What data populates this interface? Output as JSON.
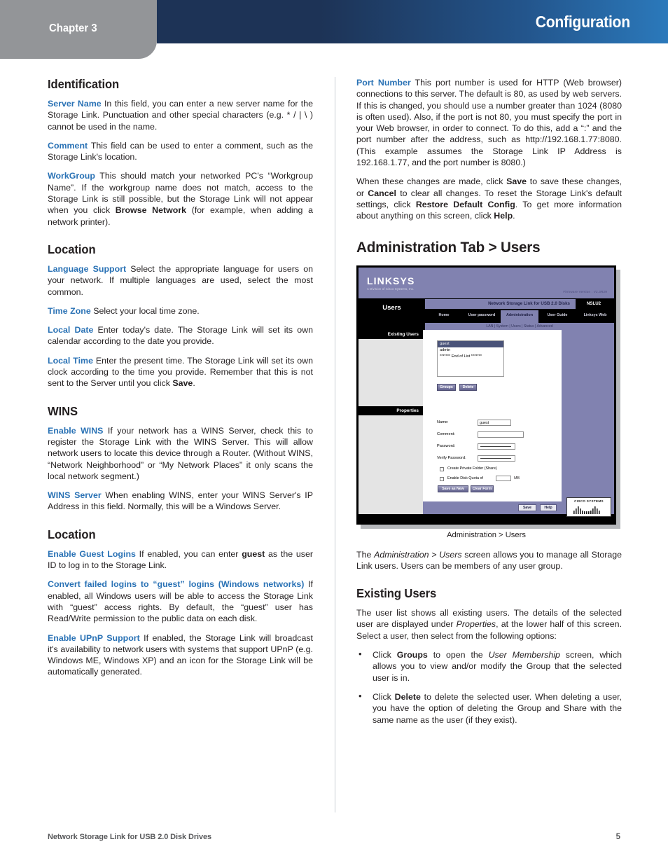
{
  "header": {
    "chapter": "Chapter 3",
    "title": "Configuration"
  },
  "left_column": {
    "identification": {
      "heading": "Identification",
      "server_name": {
        "lead": "Server Name",
        "text": " In this field, you can enter a new server name for the Storage Link. Punctuation and other special characters (e.g. * / | \\ ) cannot be used in the name."
      },
      "comment": {
        "lead": "Comment",
        "text": "  This field can be used to enter a comment, such as the Storage Link's location."
      },
      "workgroup": {
        "lead": "WorkGroup",
        "text_1": " This should match your networked PC's “Workgroup Name”. If the workgroup name does not match, access to the Storage Link is still possible, but the Storage Link will not appear when you click ",
        "bold_1": "Browse Network",
        "text_2": " (for example, when adding a network printer)."
      }
    },
    "location_1": {
      "heading": "Location",
      "language_support": {
        "lead": "Language Support",
        "text": "  Select the appropriate language for users on your network. If multiple languages are used, select the most common."
      },
      "time_zone": {
        "lead": "Time Zone",
        "text": "  Select your local time zone."
      },
      "local_date": {
        "lead": "Local Date",
        "text": "  Enter today's date. The Storage Link will set its own calendar according to the date you provide."
      },
      "local_time": {
        "lead": "Local Time",
        "text_1": " Enter the present time. The Storage Link will set its own clock according to the time you provide. Remember that this is not sent to the Server until you click ",
        "bold_1": "Save",
        "text_2": "."
      }
    },
    "wins": {
      "heading": "WINS",
      "enable_wins": {
        "lead": "Enable WINS",
        "text": "  If your network has a WINS Server, check this to register the Storage Link with the WINS Server. This will allow network users to locate this device through a Router. (Without WINS, “Network Neighborhood” or “My Network Places” it only scans the local network segment.)"
      },
      "wins_server": {
        "lead": "WINS Server",
        "text": " When enabling WINS, enter your WINS Server's IP Address in this field. Normally, this will be a Windows Server."
      }
    },
    "location_2": {
      "heading": "Location",
      "enable_guest_logins": {
        "lead": "Enable Guest Logins",
        "text_1": "  If enabled, you can enter ",
        "bold_1": "guest",
        "text_2": " as the user ID to log in to the Storage Link."
      },
      "convert_failed_logins": {
        "lead": "Convert failed logins to “guest” logins (Windows networks)",
        "text": " If enabled, all Windows users will be able to access the Storage Link with “guest” access rights. By default, the “guest” user has Read/Write permission to the public data on each disk."
      },
      "enable_upnp": {
        "lead": "Enable UPnP Support",
        "text": "  If enabled, the Storage Link will broadcast it's availability to network users with systems that support UPnP (e.g. Windows ME, Windows XP) and an icon for the Storage Link will be automatically generated."
      }
    }
  },
  "right_column": {
    "port_number": {
      "lead": "Port Number",
      "text": "  This port number is used for HTTP (Web browser) connections to this server. The default is 80, as used by web servers. If this is changed, you should use a number greater than 1024 (8080 is often used). Also, if the port is not 80, you must specify the port in your Web browser, in order to connect. To do this, add a “:” and the port number after the address, such as http://192.168.1.77:8080. (This example assumes the Storage Link IP Address is 192.168.1.77, and the port number is 8080.)"
    },
    "save_paragraph": {
      "text_1": "When these changes are made, click ",
      "bold_1": "Save",
      "text_2": " to save these changes, or ",
      "bold_2": "Cancel",
      "text_3": " to clear all changes. To reset the Storage Link's default settings, click ",
      "bold_3": "Restore Default Config",
      "text_4": ". To get more information about anything on this screen, click ",
      "bold_4": "Help",
      "text_5": "."
    },
    "admin_tab_heading": "Administration Tab > Users",
    "figure_caption": "Administration > Users",
    "intro_paragraph": {
      "text_1": "The ",
      "ital_1": "Administration > Users",
      "text_2": " screen allows you to manage all Storage Link users. Users can be members of any user group."
    },
    "existing_users": {
      "heading": "Existing Users",
      "paragraph": {
        "text_1": "The user list shows all existing users. The details of the selected user are displayed under ",
        "ital_1": "Properties",
        "text_2": ", at the lower half of this screen. Select a user, then select from the following options:"
      },
      "bullets": [
        {
          "text_1": "Click ",
          "bold_1": "Groups",
          "text_2": " to open the ",
          "ital_1": "User Membership",
          "text_3": " screen, which allows you to view and/or modify the Group that the selected user is in."
        },
        {
          "text_1": "Click ",
          "bold_1": "Delete",
          "text_2": " to delete the selected user. When deleting a user, you have the option of deleting the Group and Share with the same name as the user (if they exist)."
        }
      ]
    }
  },
  "figure": {
    "brand": "LINKSYS",
    "brand_sub": "A Division of Cisco Systems, Inc.",
    "firmware": "Firmware Version : V2.3R29",
    "page_title": "Users",
    "product_bar": "Network Storage Link for USB 2.0 Disks",
    "model": "NSLU2",
    "tabs": [
      {
        "label": "Home",
        "selected": false
      },
      {
        "label": "User password",
        "selected": false
      },
      {
        "label": "Administration",
        "selected": true
      },
      {
        "label": "User Guide",
        "selected": false
      },
      {
        "label": "Linksys Web",
        "selected": false
      }
    ],
    "subnav": "LAN  |  System  |  Users  |  Status  |  Advanced",
    "label_existing_users": "Existing Users",
    "label_properties": "Properties",
    "user_list": [
      {
        "value": "guest",
        "selected": true
      },
      {
        "value": "admin",
        "selected": false
      },
      {
        "value": "******* End of List *******",
        "selected": false
      }
    ],
    "btn_groups": "Groups",
    "btn_delete": "Delete",
    "form": {
      "name_label": "Name:",
      "name_value": "guest",
      "comment_label": "Comment:",
      "comment_value": "",
      "password_label": "Password:",
      "verify_label": "Verify Password:",
      "chk_private_folder": "Create Private Folder (Share)",
      "chk_disk_quota": "Enable Disk Quota of",
      "quota_value": "",
      "quota_unit": "MB",
      "btn_save_new": "Save as New User",
      "btn_clear": "Clear Form"
    },
    "btn_save": "Save",
    "btn_help": "Help",
    "cisco_logo_text": "CISCO SYSTEMS"
  },
  "footer": {
    "title": "Network Storage Link for USB 2.0 Disk Drives",
    "page_number": "5"
  }
}
